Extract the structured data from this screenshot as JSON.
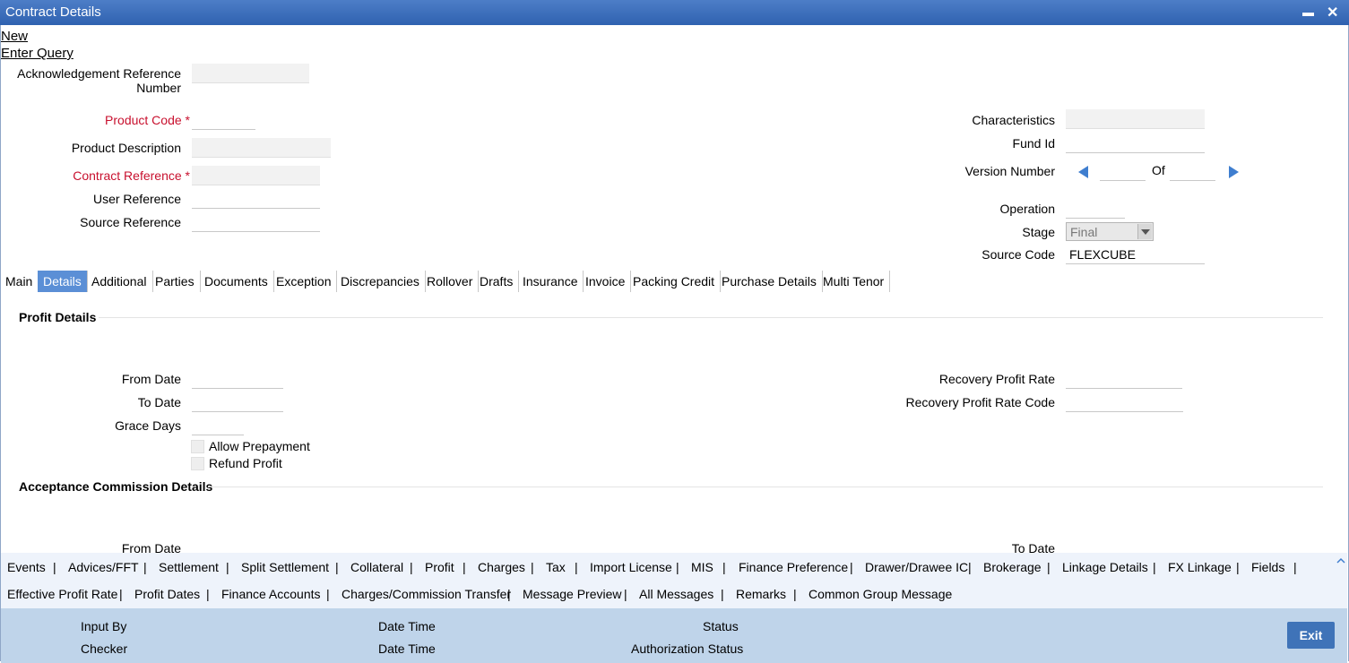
{
  "window": {
    "title": "Contract Details",
    "minimize": "▬",
    "close": "✕"
  },
  "actions": {
    "new": "New",
    "enter_query": "Enter Query"
  },
  "form": {
    "ack_ref_label_1": "Acknowledgement Reference",
    "ack_ref_label_2": "Number",
    "product_code_label": "Product Code",
    "product_description_label": "Product Description",
    "contract_reference_label": "Contract Reference",
    "user_reference_label": "User Reference",
    "source_reference_label": "Source Reference",
    "required_mark": "*",
    "characteristics_label": "Characteristics",
    "fund_id_label": "Fund Id",
    "version_number_label": "Version Number",
    "version_of": "Of",
    "operation_label": "Operation",
    "stage_label": "Stage",
    "stage_value": "Final",
    "source_code_label": "Source Code",
    "source_code_value": "FLEXCUBE"
  },
  "tabs": [
    "Main",
    "Details",
    "Additional",
    "Parties",
    "Documents",
    "Exception",
    "Discrepancies",
    "Rollover",
    "Drafts",
    "Insurance",
    "Invoice",
    "Packing Credit",
    "Purchase Details",
    "Multi Tenor"
  ],
  "active_tab": "Details",
  "profit": {
    "section_title": "Profit Details",
    "from_date_label": "From Date",
    "to_date_label": "To Date",
    "grace_days_label": "Grace Days",
    "allow_prepayment_label": "Allow Prepayment",
    "refund_profit_label": "Refund Profit",
    "recovery_rate_label": "Recovery Profit Rate",
    "recovery_rate_code_label": "Recovery Profit Rate Code"
  },
  "acceptance": {
    "section_title": "Acceptance Commission Details",
    "from_date_label": "From Date",
    "to_date_label": "To Date"
  },
  "sub_links_row1": [
    "Events",
    "Advices/FFT",
    "Settlement",
    "Split Settlement",
    "Collateral",
    "Profit",
    "Charges",
    "Tax",
    "Import License",
    "MIS",
    "Finance Preference",
    "Drawer/Drawee IC",
    "Brokerage",
    "Linkage Details",
    "FX Linkage",
    "Fields"
  ],
  "sub_links_row2": [
    "Effective Profit Rate",
    "Profit Dates",
    "Finance Accounts",
    "Charges/Commission Transfer",
    "Message Preview",
    "All Messages",
    "Remarks",
    "Common Group Message"
  ],
  "separator": "|",
  "footer": {
    "input_by": "Input By",
    "checker": "Checker",
    "date_time_1": "Date Time",
    "date_time_2": "Date Time",
    "status": "Status",
    "auth_status": "Authorization Status",
    "exit": "Exit"
  }
}
